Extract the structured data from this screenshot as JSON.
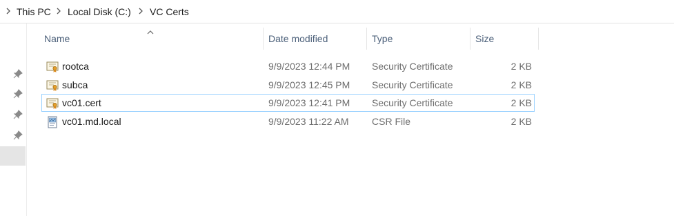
{
  "breadcrumb": {
    "items": [
      "This PC",
      "Local Disk (C:)",
      "VC Certs"
    ]
  },
  "columns": {
    "name": "Name",
    "date_modified": "Date modified",
    "type": "Type",
    "size": "Size"
  },
  "files": [
    {
      "name": "rootca",
      "date": "9/9/2023 12:44 PM",
      "type": "Security Certificate",
      "size": "2 KB",
      "icon": "certificate-file-icon"
    },
    {
      "name": "subca",
      "date": "9/9/2023 12:45 PM",
      "type": "Security Certificate",
      "size": "2 KB",
      "icon": "certificate-file-icon"
    },
    {
      "name": "vc01.cert",
      "date": "9/9/2023 12:41 PM",
      "type": "Security Certificate",
      "size": "2 KB",
      "icon": "certificate-file-icon",
      "selected": true
    },
    {
      "name": "vc01.md.local",
      "date": "9/9/2023 11:22 AM",
      "type": "CSR File",
      "size": "2 KB",
      "icon": "csr-file-icon"
    }
  ],
  "colors": {
    "header_text": "#4c607a",
    "selection_border": "#99d1ff",
    "secondary_text": "#6d6d6d"
  }
}
